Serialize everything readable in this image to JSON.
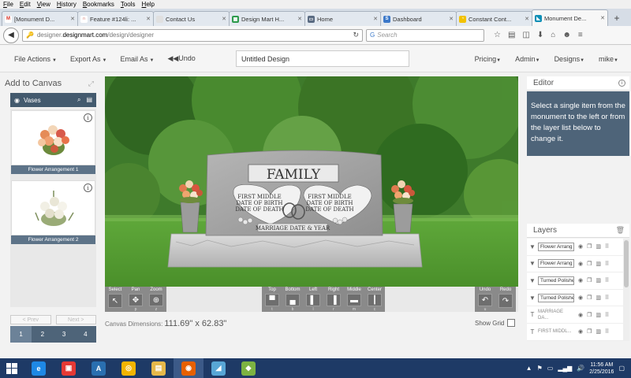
{
  "browser": {
    "menu": [
      "File",
      "Edit",
      "View",
      "History",
      "Bookmarks",
      "Tools",
      "Help"
    ],
    "tabs": [
      {
        "title": "[Monument D...",
        "icon_color": "#ffffff",
        "icon_glyph": "M",
        "icon_text_color": "#d93025",
        "active": false
      },
      {
        "title": "Feature #124li: ...",
        "icon_color": "#ffffff",
        "icon_glyph": "∩",
        "icon_text_color": "#c0392b",
        "active": false
      },
      {
        "title": "Contact Us",
        "icon_color": "#e0e0e0",
        "icon_glyph": "",
        "icon_text_color": "#888888",
        "active": false
      },
      {
        "title": "Design Mart H...",
        "icon_color": "#2e9b4d",
        "icon_glyph": "▦",
        "icon_text_color": "#ffffff",
        "active": false
      },
      {
        "title": "Home",
        "icon_color": "#5a6b82",
        "icon_glyph": "▭",
        "icon_text_color": "#ffffff",
        "active": false
      },
      {
        "title": "Dashboard",
        "icon_color": "#3b78c9",
        "icon_glyph": "S",
        "icon_text_color": "#ffffff",
        "active": false
      },
      {
        "title": "Constant Cont...",
        "icon_color": "#f2c200",
        "icon_glyph": "◔",
        "icon_text_color": "#ffffff",
        "active": false
      },
      {
        "title": "Monument De...",
        "icon_color": "#0f8fb6",
        "icon_glyph": "◣",
        "icon_text_color": "#ffffff",
        "active": true
      }
    ],
    "url_prefix": "designer.",
    "url_domain": "designmart.com",
    "url_path": "/design/designer",
    "search_placeholder": "Search"
  },
  "app": {
    "menus_left": [
      "File Actions",
      "Export As",
      "Email As"
    ],
    "undo_label": "Undo",
    "design_name": "Untitled Design",
    "menus_right": [
      "Pricing",
      "Admin",
      "Designs",
      "mike"
    ]
  },
  "left_panel": {
    "title": "Add to Canvas",
    "category": "Vases",
    "items": [
      {
        "label": "Flower Arrangement 1"
      },
      {
        "label": "Flower Arrangement 2"
      }
    ],
    "prev_label": "< Prev",
    "next_label": "Next >",
    "pages": [
      "1",
      "2",
      "3",
      "4"
    ],
    "active_page": "1"
  },
  "canvas": {
    "headstone_title": "FAMILY",
    "left_heart": [
      "FIRST MIDDLE",
      "DATE OF BIRTH",
      "DATE OF DEATH"
    ],
    "right_heart": [
      "FIRST MIDDLE",
      "DATE OF BIRTH",
      "DATE OF DEATH"
    ],
    "marriage_text": "MARRIAGE DATE & YEAR"
  },
  "toolbar": {
    "groups": [
      {
        "buttons": [
          {
            "label": "Select",
            "glyph": "↖",
            "sub": ""
          },
          {
            "label": "Pan",
            "glyph": "✥",
            "sub": "p"
          },
          {
            "label": "Zoom",
            "glyph": "⊕",
            "sub": "z"
          }
        ]
      },
      {
        "buttons": [
          {
            "label": "Top",
            "glyph": "▀",
            "sub": "t"
          },
          {
            "label": "Bottom",
            "glyph": "▄",
            "sub": "b"
          },
          {
            "label": "Left",
            "glyph": "▌",
            "sub": "l"
          },
          {
            "label": "Right",
            "glyph": "▐",
            "sub": "r"
          },
          {
            "label": "Middle",
            "glyph": "▬",
            "sub": "m"
          },
          {
            "label": "Center",
            "glyph": "┃",
            "sub": "c"
          }
        ]
      },
      {
        "buttons": [
          {
            "label": "Undo",
            "glyph": "↶",
            "sub": "u"
          },
          {
            "label": "Redo",
            "glyph": "↷",
            "sub": ""
          }
        ]
      }
    ],
    "dims_label": "Canvas Dimensions:",
    "dims_value": "111.69\" x 62.83\"",
    "show_grid_label": "Show Grid"
  },
  "editor": {
    "title": "Editor",
    "message": "Select a single item from the monument to the left or from the layer list below to change it."
  },
  "layers": {
    "title": "Layers",
    "items": [
      {
        "type": "image",
        "name": "Flower Arrang"
      },
      {
        "type": "image",
        "name": "Flower Arrang"
      },
      {
        "type": "image",
        "name": "Turned Polishe"
      },
      {
        "type": "image",
        "name": "Turned Polishe"
      },
      {
        "type": "text",
        "name": "MARRIAGE DA..."
      },
      {
        "type": "text",
        "name": "FIRST MIDDL..."
      }
    ]
  },
  "taskbar": {
    "apps": [
      {
        "name": "internet-explorer",
        "color": "#1e88e5",
        "glyph": "e"
      },
      {
        "name": "toolbox",
        "color": "#e53935",
        "glyph": "▣"
      },
      {
        "name": "a-app",
        "color": "#2a6fb0",
        "glyph": "A"
      },
      {
        "name": "chrome",
        "color": "#f4b400",
        "glyph": "◎"
      },
      {
        "name": "file-explorer",
        "color": "#e6b84a",
        "glyph": "▤"
      },
      {
        "name": "firefox",
        "color": "#e66000",
        "glyph": "◉"
      },
      {
        "name": "paint",
        "color": "#58a6d6",
        "glyph": "◢"
      },
      {
        "name": "launcher",
        "color": "#7cb342",
        "glyph": "◆"
      }
    ],
    "time": "11:56 AM",
    "date": "2/25/2016"
  }
}
